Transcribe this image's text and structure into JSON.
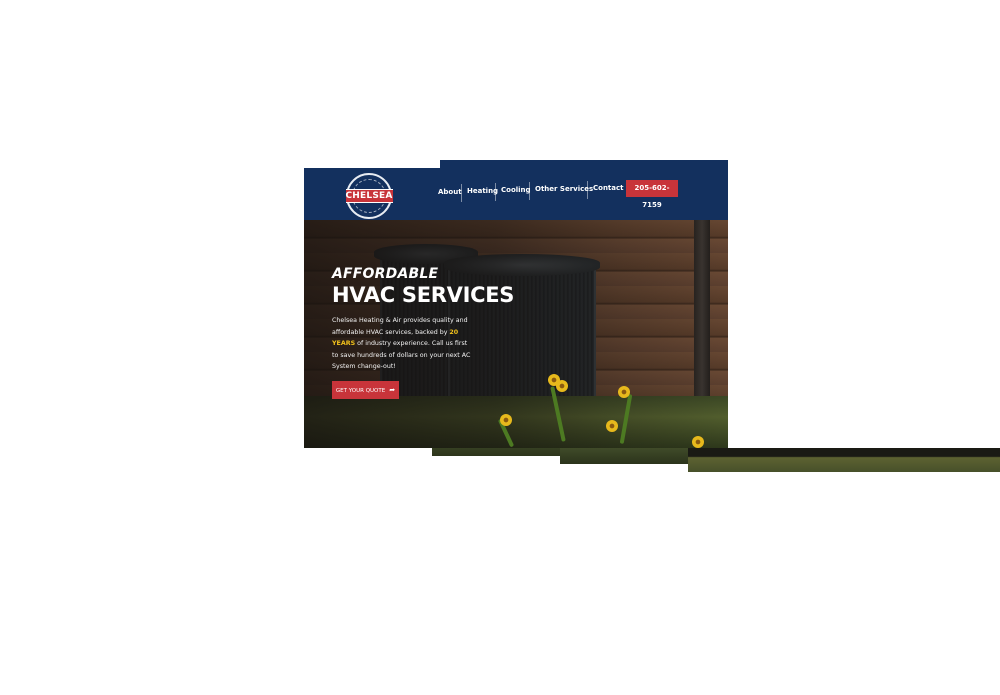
{
  "brand": {
    "logo_text": "CHELSEA"
  },
  "nav": {
    "items": [
      {
        "label": "About"
      },
      {
        "label": "Heating"
      },
      {
        "label": "Cooling"
      },
      {
        "label": "Other Services"
      },
      {
        "label": "Contact"
      }
    ],
    "phone_label": "205-602-7159"
  },
  "hero": {
    "eyebrow": "AFFORDABLE",
    "headline": "HVAC SERVICES",
    "body_before": "Chelsea Heating & Air provides quality and affordable HVAC services, backed by ",
    "body_highlight": "20 YEARS",
    "body_after": " of industry experience. Call us first to save hundreds of dollars on your next AC System change-out!",
    "cta_label": "GET YOUR QUOTE",
    "cta_icon": "share-arrow-icon"
  },
  "colors": {
    "header_bg": "#13305e",
    "accent_red": "#c8343a",
    "highlight_yellow": "#f2c21b"
  }
}
